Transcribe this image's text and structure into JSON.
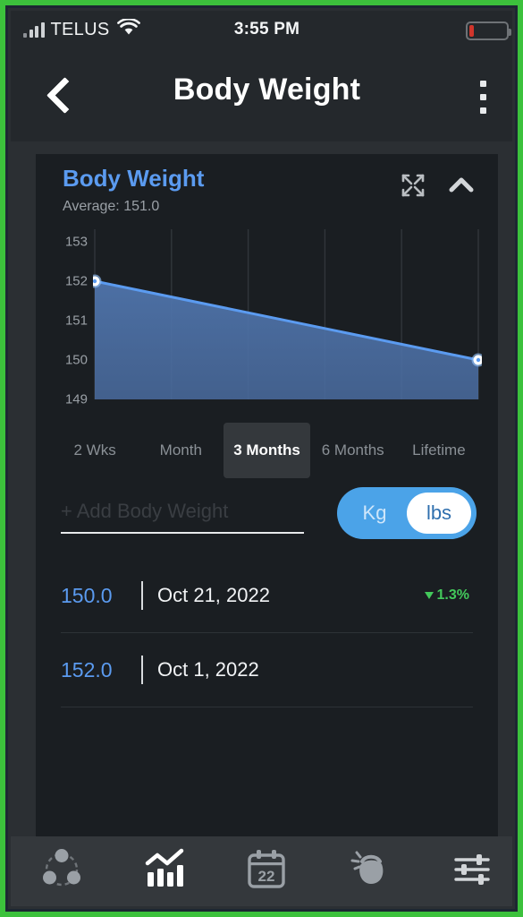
{
  "status_bar": {
    "carrier": "TELUS",
    "time": "3:55 PM",
    "signal_icon": "signal-bars-icon",
    "wifi_icon": "wifi-icon",
    "battery_icon": "battery-low-icon"
  },
  "nav": {
    "back_icon": "chevron-left-icon",
    "title": "Body Weight",
    "menu_icon": "kebab-menu-icon"
  },
  "card": {
    "title": "Body Weight",
    "subtitle": "Average: 151.0",
    "expand_icon": "expand-arrows-icon",
    "collapse_icon": "chevron-up-icon"
  },
  "chart_data": {
    "type": "area",
    "title": "Body Weight",
    "xlabel": "",
    "ylabel": "",
    "ylim": [
      149,
      153
    ],
    "yticks": [
      153,
      152,
      151,
      150,
      149
    ],
    "grid": true,
    "legend": "none",
    "x": [
      "Oct 1, 2022",
      "Oct 21, 2022"
    ],
    "values": [
      152.0,
      150.0
    ],
    "series": [
      {
        "name": "Body Weight",
        "values": [
          152.0,
          150.0
        ]
      }
    ],
    "line_color": "#5b9bf0",
    "fill_color": "#4a6c9e",
    "point_color": "#ffffff",
    "average": 151.0
  },
  "ranges": {
    "selected": "3 Months",
    "options": [
      "2 Wks",
      "Month",
      "3 Months",
      "6 Months",
      "Lifetime"
    ]
  },
  "add_entry": {
    "placeholder": "+ Add Body Weight",
    "value": ""
  },
  "unit_toggle": {
    "kg_label": "Kg",
    "lbs_label": "lbs",
    "selected": "lbs",
    "track_color": "#4ba3e8"
  },
  "entries": [
    {
      "value": "150.0",
      "date": "Oct 21, 2022",
      "delta": "1.3%",
      "delta_direction": "down",
      "delta_color": "#43c95b"
    },
    {
      "value": "152.0",
      "date": "Oct 1, 2022",
      "delta": "",
      "delta_direction": "",
      "delta_color": ""
    }
  ],
  "tabbar": {
    "items": [
      {
        "icon": "triad-circles-icon",
        "active": false
      },
      {
        "icon": "bar-line-chart-icon",
        "active": true
      },
      {
        "icon": "calendar-22-icon",
        "active": false
      },
      {
        "icon": "kettlebell-icon",
        "active": false
      },
      {
        "icon": "sliders-icon",
        "active": false
      }
    ]
  }
}
